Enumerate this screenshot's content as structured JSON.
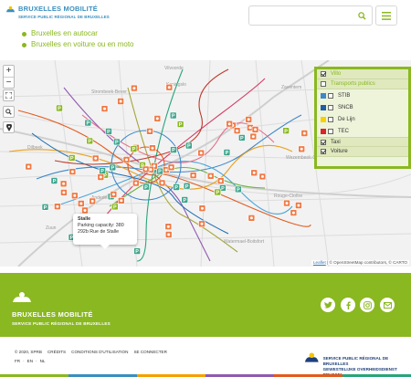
{
  "header": {
    "logo_name": "BRUXELLES MOBILITÉ",
    "logo_sub": "SERVICE PUBLIC RÉGIONAL DE BRUXELLES",
    "search_value": "",
    "search_icon": "search-icon",
    "menu_icon": "hamburger-menu-icon"
  },
  "links": [
    {
      "label": "Bruxelles en autocar"
    },
    {
      "label": "Bruxelles en voiture ou en moto"
    }
  ],
  "map": {
    "zoom_in": "+",
    "zoom_out": "−",
    "controls": [
      "fullscreen-icon",
      "search-icon",
      "locate-icon"
    ],
    "popup": {
      "title": "Stalle",
      "line1": "Parking capacity: 380",
      "line2": "292b Rue de Stalle"
    },
    "layers": {
      "villo": "Villo",
      "transports": "Transports publics",
      "stib": "STIB",
      "sncb": "SNCB",
      "delijn": "De Lijn",
      "tec": "TEC",
      "taxi": "Taxi",
      "voiture": "Voiture"
    },
    "attrib_leaflet": "Leaflet",
    "attrib_rest": "| © OpenStreetMap contributors, © CARTO",
    "place_labels": [
      "Vilvoorde",
      "Koningslo",
      "Zaventem",
      "Strombeek-Bever",
      "Dilbeek",
      "Anderlecht",
      "Watermael-Boitsfort",
      "Wezembeek-Oppem",
      "Zuun",
      "Rouge-Cloître"
    ]
  },
  "footer": {
    "name": "BRUXELLES MOBILITÉ",
    "sub": "SERVICE PUBLIC RÉGIONAL DE BRUXELLES",
    "social": [
      "twitter-icon",
      "facebook-icon",
      "instagram-icon",
      "mail-icon"
    ],
    "legal": [
      "© 2020, SPRB",
      "CRÉDITS",
      "CONDITIONS D'UTILISATION",
      "SE CONNECTER"
    ],
    "langs": [
      "FR",
      "·",
      "EN",
      "·",
      "NL"
    ],
    "region_fr": "SERVICE PUBLIC RÉGIONAL DE BRUXELLES",
    "region_nl": "GEWESTELIJKE OVERHEIDSDIENST BRUSSEL"
  },
  "colors": {
    "accent": "#8ab820",
    "brand_blue": "#3a8fbe",
    "navy": "#1e3f7a"
  }
}
